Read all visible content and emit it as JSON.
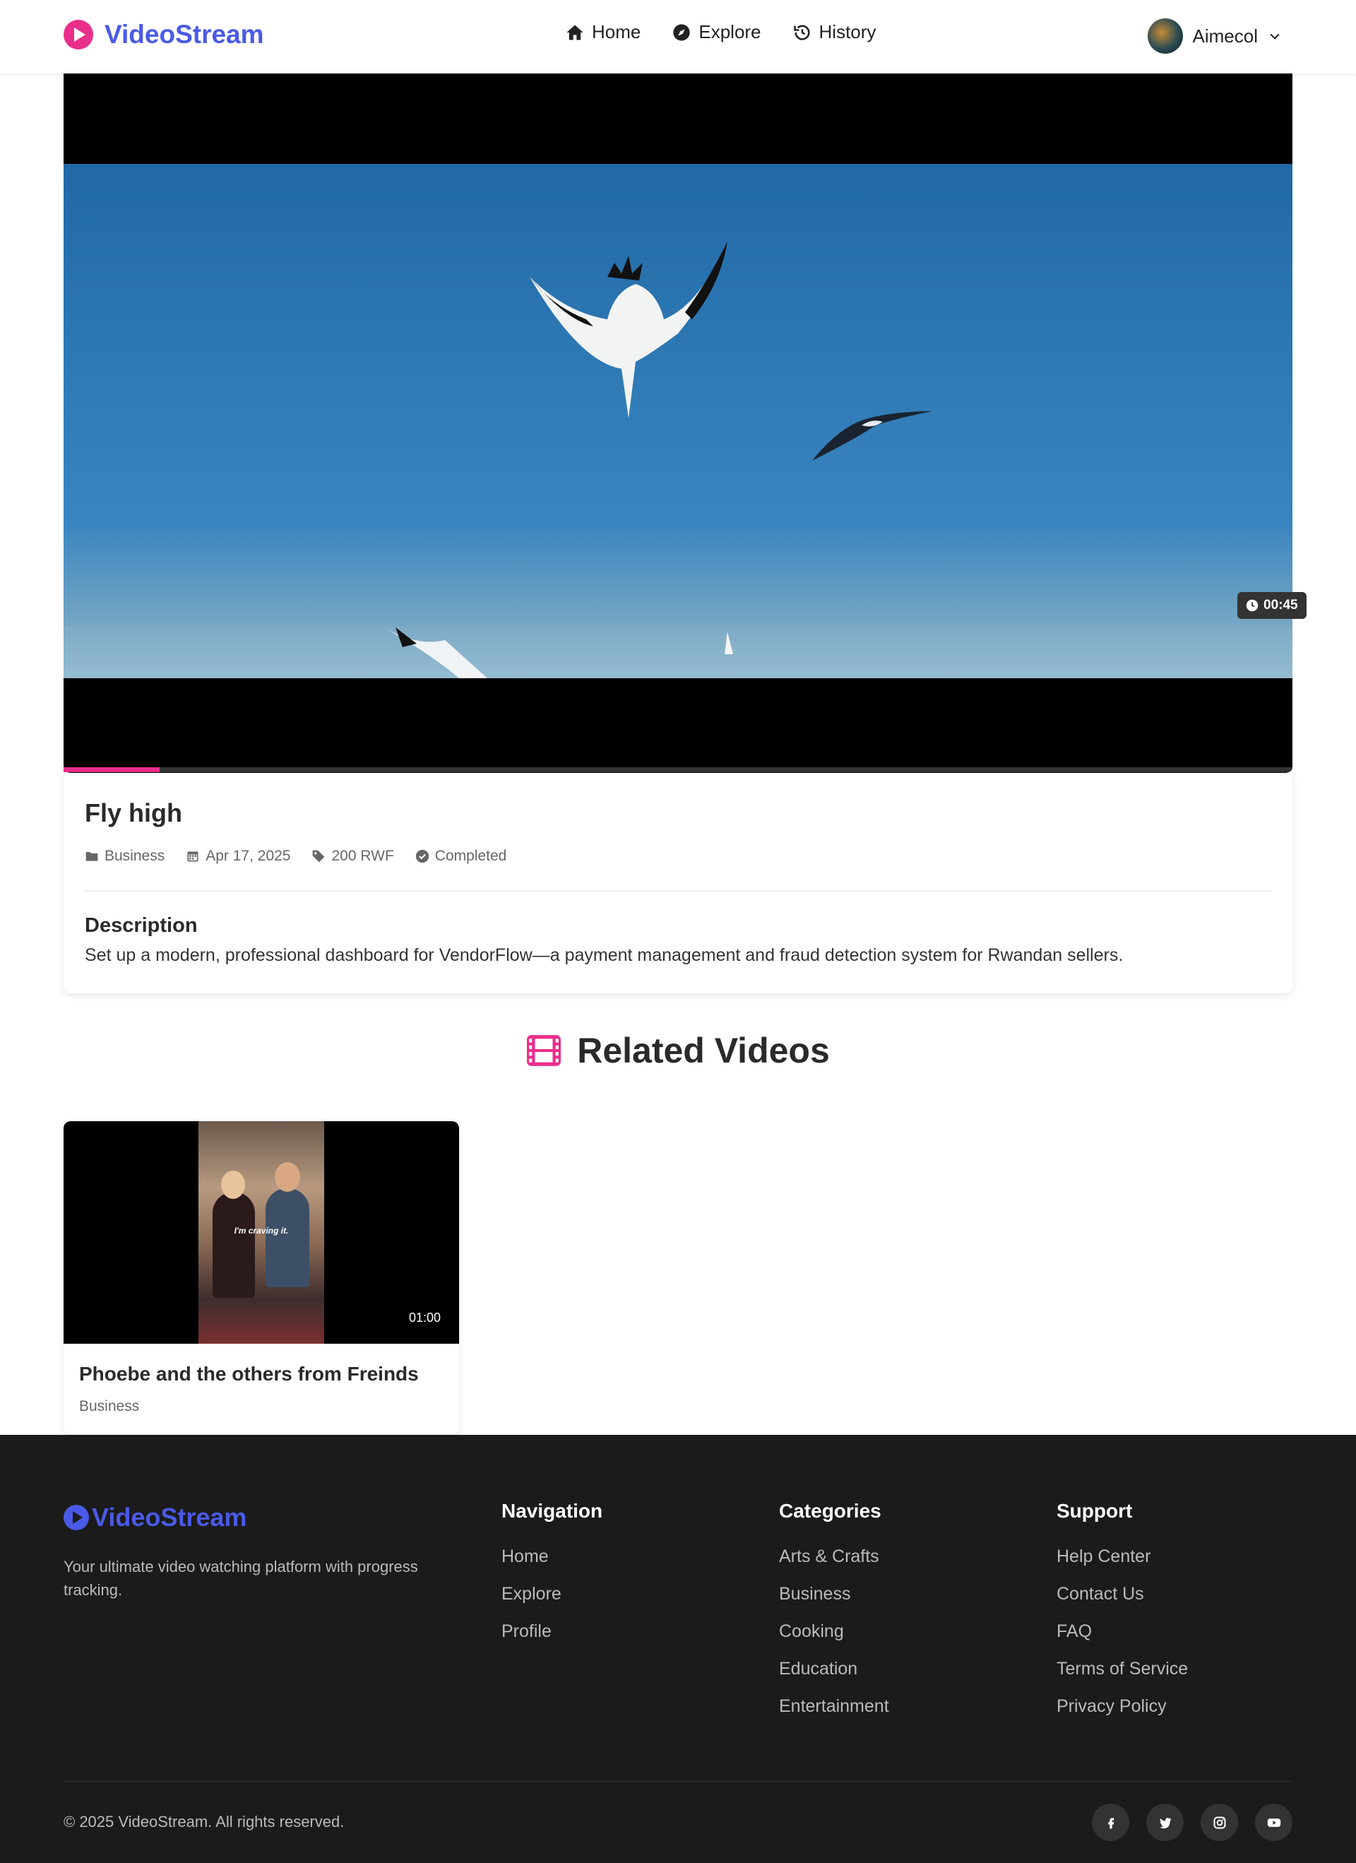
{
  "header": {
    "logo_text": "VideoStream",
    "nav": [
      {
        "label": "Home",
        "icon": "home-icon"
      },
      {
        "label": "Explore",
        "icon": "compass-icon"
      },
      {
        "label": "History",
        "icon": "history-icon"
      }
    ],
    "user_name": "Aimecol"
  },
  "player": {
    "duration": "00:45",
    "progress_fraction": 0.078,
    "accent_color": "#ea2e8b"
  },
  "video": {
    "title": "Fly high",
    "category": "Business",
    "date": "Apr 17, 2025",
    "price": "200 RWF",
    "status": "Completed",
    "description_heading": "Description",
    "description": "Set up a modern, professional dashboard for VendorFlow—a payment management and fraud detection system for Rwandan sellers."
  },
  "related": {
    "heading": "Related Videos",
    "items": [
      {
        "title": "Phoebe and the others from Freinds",
        "category": "Business",
        "duration": "01:00",
        "caption": "I'm craving it."
      }
    ]
  },
  "footer": {
    "logo_text": "VideoStream",
    "tagline": "Your ultimate video watching platform with progress tracking.",
    "navigation": {
      "title": "Navigation",
      "links": [
        "Home",
        "Explore",
        "Profile"
      ]
    },
    "categories": {
      "title": "Categories",
      "links": [
        "Arts & Crafts",
        "Business",
        "Cooking",
        "Education",
        "Entertainment"
      ]
    },
    "support": {
      "title": "Support",
      "links": [
        "Help Center",
        "Contact Us",
        "FAQ",
        "Terms of Service",
        "Privacy Policy"
      ]
    },
    "copyright": "© 2025 VideoStream. All rights reserved.",
    "socials": [
      "facebook-icon",
      "twitter-icon",
      "instagram-icon",
      "youtube-icon"
    ]
  },
  "colors": {
    "brand_blue": "#4a5ae8",
    "brand_pink": "#ea2e8b",
    "footer_bg": "#1b1b1c"
  }
}
